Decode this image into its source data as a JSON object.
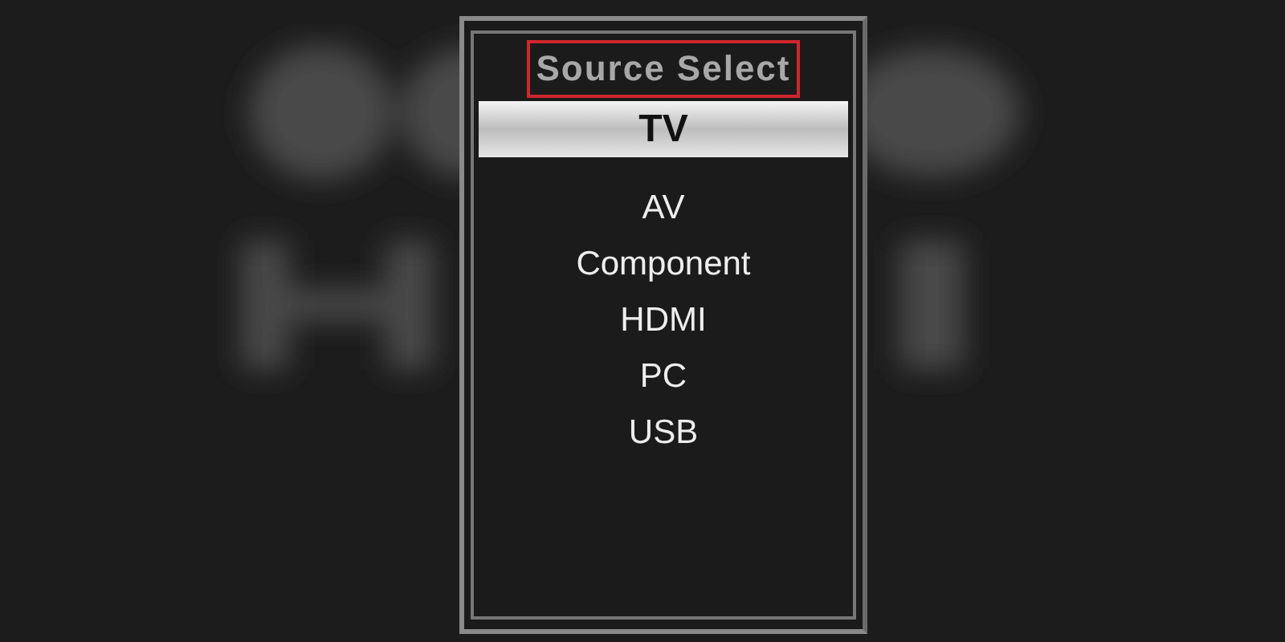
{
  "menu": {
    "title": "Source Select",
    "items": [
      {
        "label": "TV",
        "selected": true
      },
      {
        "label": "AV",
        "selected": false
      },
      {
        "label": "Component",
        "selected": false
      },
      {
        "label": "HDMI",
        "selected": false
      },
      {
        "label": "PC",
        "selected": false
      },
      {
        "label": "USB",
        "selected": false
      }
    ]
  }
}
